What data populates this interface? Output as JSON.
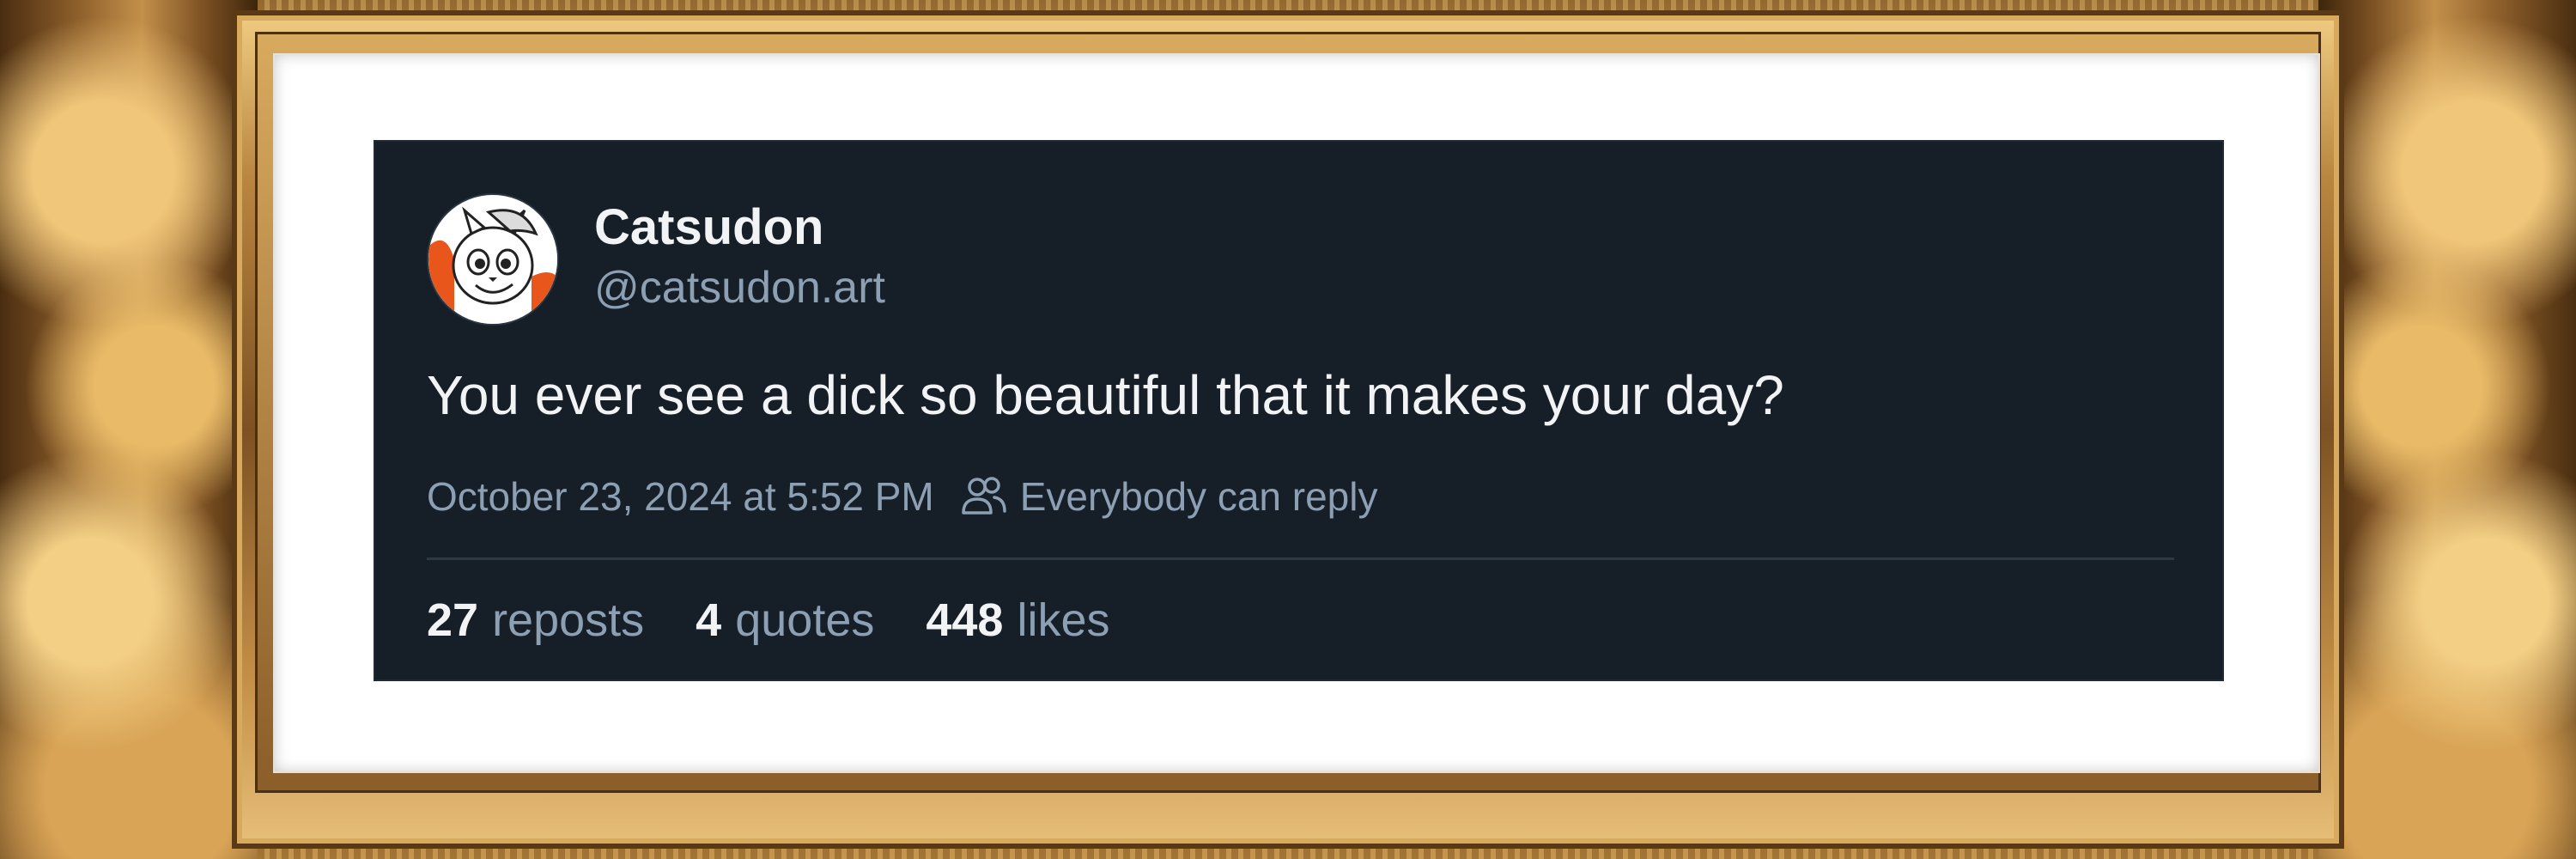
{
  "post": {
    "author": {
      "display_name": "Catsudon",
      "handle": "@catsudon.art",
      "avatar_icon": "cartoon-cat-avatar"
    },
    "text": "You ever see a dick so beautiful that it makes your day?",
    "timestamp": "October 23, 2024 at 5:52 PM",
    "reply_setting": {
      "icon": "people-icon",
      "label": "Everybody can reply"
    },
    "stats": {
      "reposts": {
        "count": "27",
        "label": "reposts"
      },
      "quotes": {
        "count": "4",
        "label": "quotes"
      },
      "likes": {
        "count": "448",
        "label": "likes"
      }
    }
  },
  "colors": {
    "card_background": "#161e27",
    "primary_text": "#f1f3f5",
    "secondary_text": "#8d9fb3",
    "divider": "#2b3846",
    "frame_gold": "#b9873f",
    "mat": "#ffffff"
  }
}
